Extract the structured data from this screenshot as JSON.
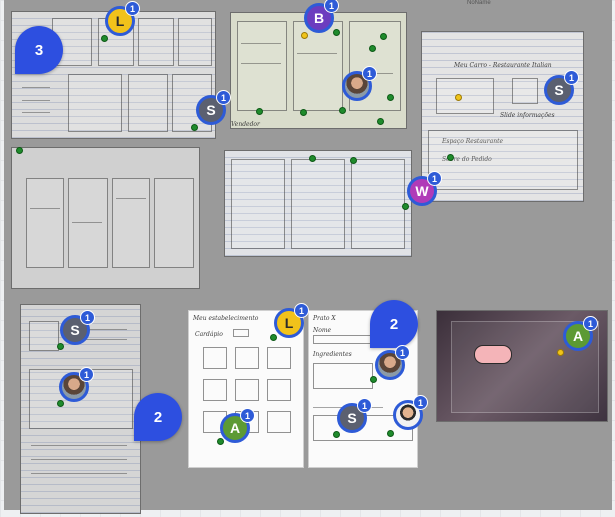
{
  "board": {
    "top_right_label": "NoName"
  },
  "count_bubbles": [
    {
      "label": "3"
    },
    {
      "label": "2"
    },
    {
      "label": "2"
    }
  ],
  "avatars": {
    "l1": {
      "initial": "L",
      "count": "1",
      "color": "#f1c21b",
      "text_color": "#2b2b2b"
    },
    "s1": {
      "initial": "S",
      "count": "1",
      "color": "#5b6070"
    },
    "b1": {
      "initial": "B",
      "count": "1",
      "color": "#6c3dbf"
    },
    "p1": {
      "initial": "",
      "count": "1"
    },
    "s2": {
      "initial": "S",
      "count": "1",
      "color": "#5b6070"
    },
    "w1": {
      "initial": "W",
      "count": "1",
      "color": "#b03bb8"
    },
    "s3": {
      "initial": "S",
      "count": "1",
      "color": "#5b6070"
    },
    "p2": {
      "initial": "",
      "count": "1"
    },
    "l2": {
      "initial": "L",
      "count": "1",
      "color": "#f1c21b",
      "text_color": "#2b2b2b"
    },
    "p3": {
      "initial": "",
      "count": "1"
    },
    "a1": {
      "initial": "A",
      "count": "1",
      "color": "#5c9a34"
    },
    "s4": {
      "initial": "S",
      "count": "1",
      "color": "#5b6070"
    },
    "p4": {
      "initial": "",
      "count": "1"
    },
    "a2": {
      "initial": "A",
      "count": "1",
      "color": "#5c9a34"
    }
  },
  "sketch_text": {
    "p3_title": "Meu Carro - Restaurante Italian",
    "p3_label_a": "Espaço Restaurante",
    "p3_label_b": "Slide informações",
    "p3_notes": "Sobre do Pedido",
    "p2_bottom": "Vendedor",
    "p8_title": "Meu estabelecimento",
    "p8_sub": "Cardápio",
    "p9_title": "Prato X",
    "p9_name": "Nome",
    "p9_ingredients": "Ingredientes"
  }
}
